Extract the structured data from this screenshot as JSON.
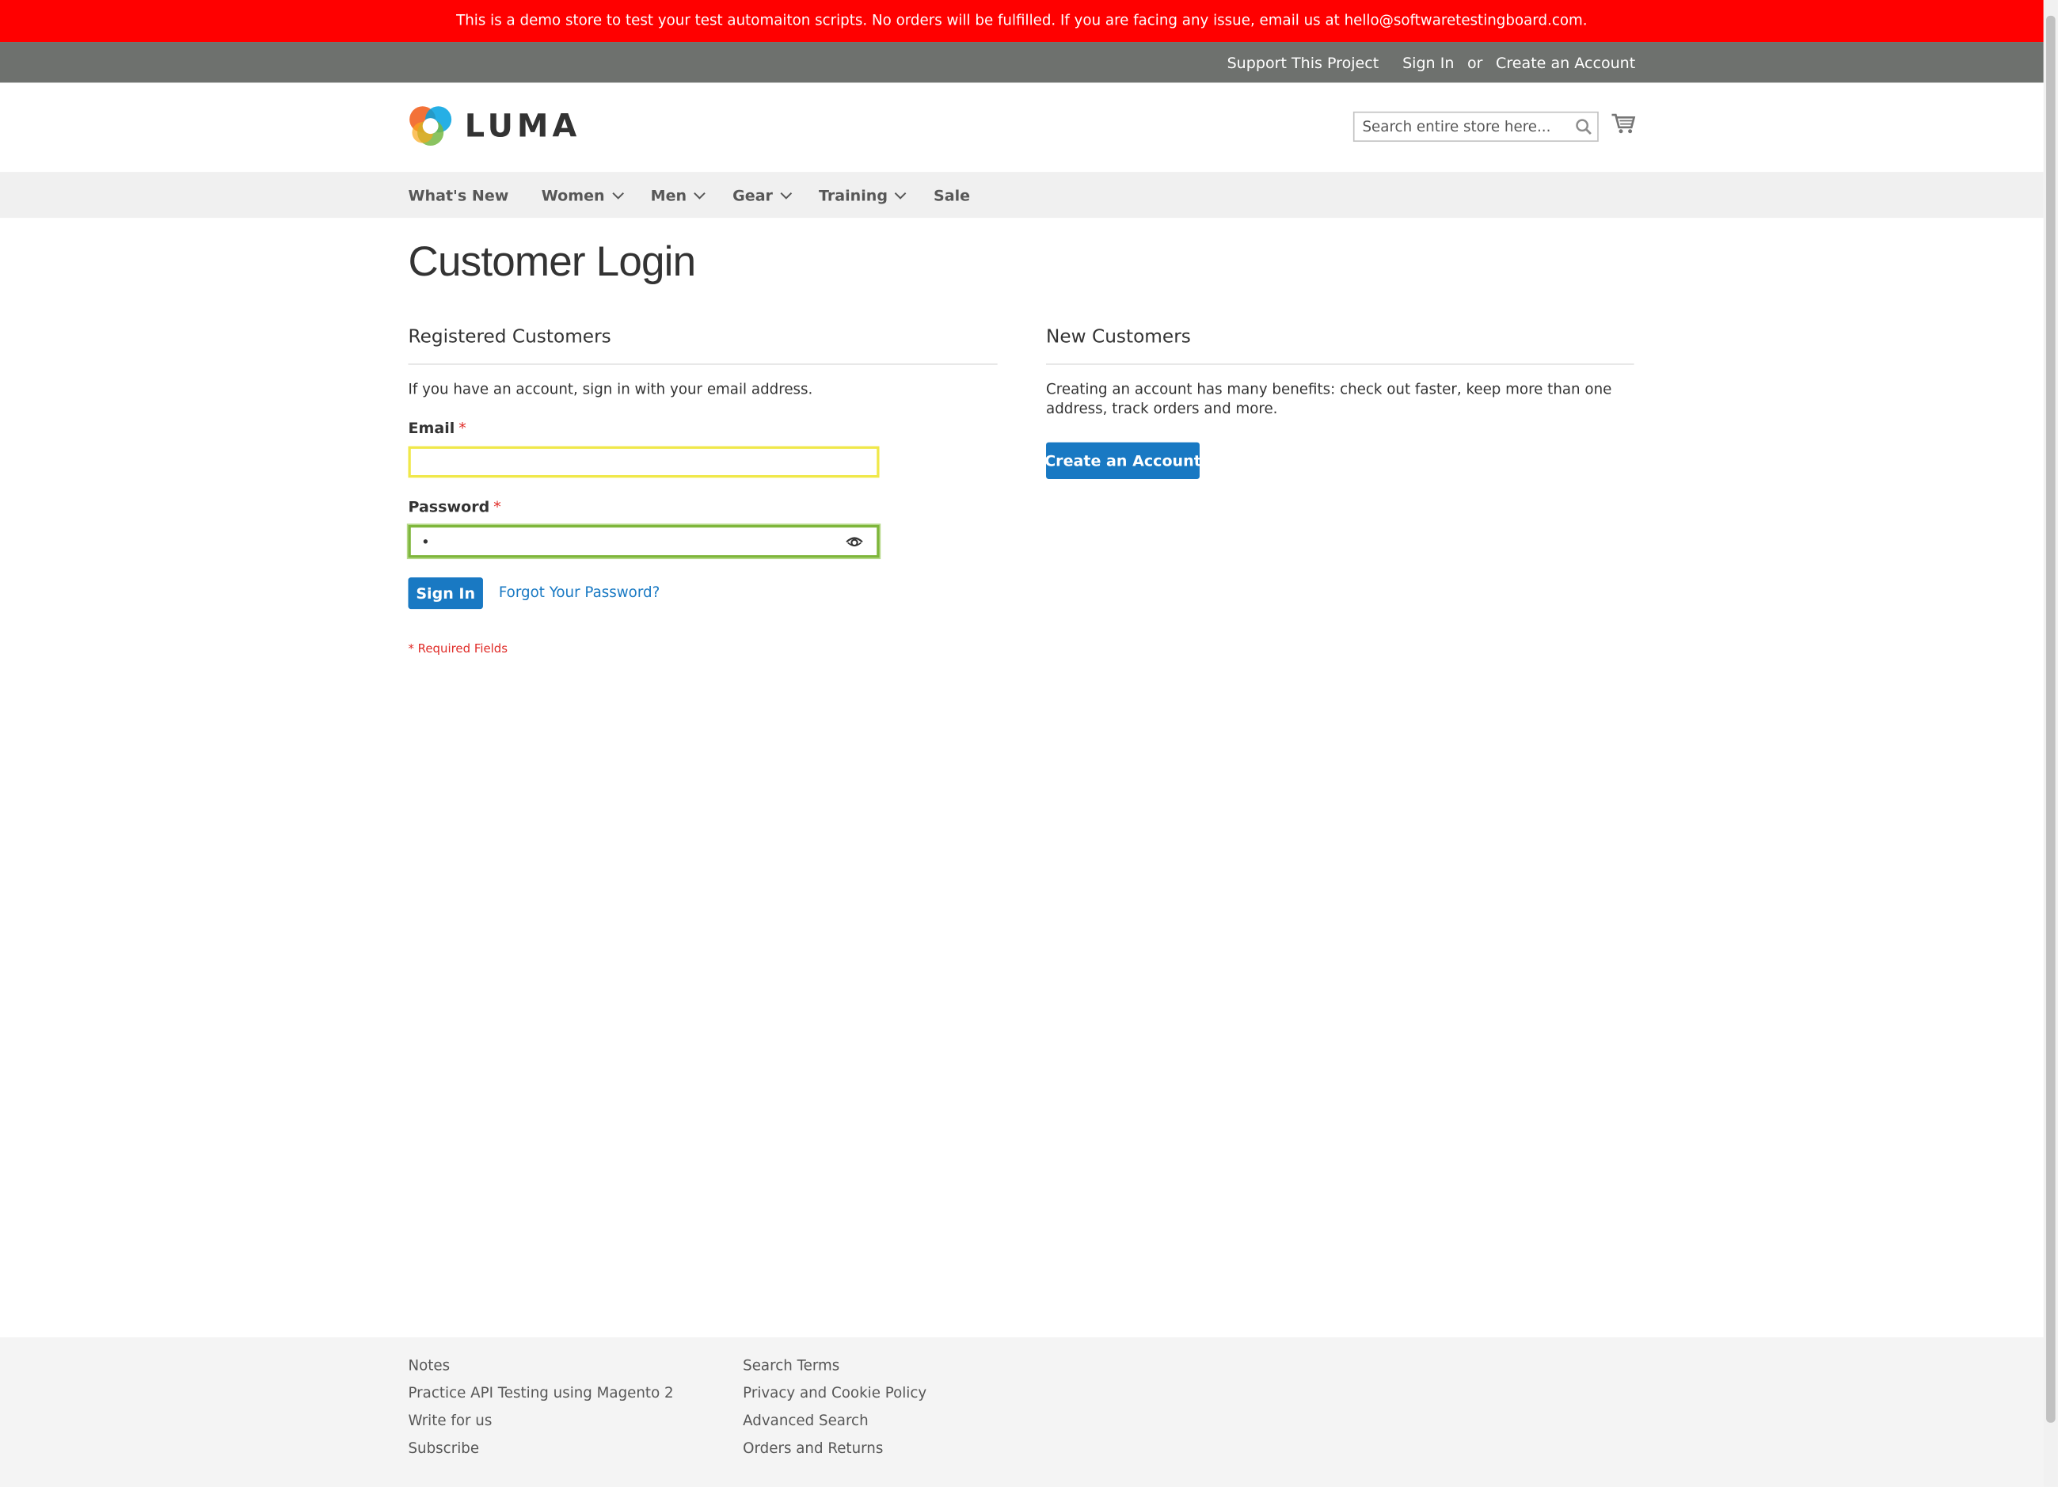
{
  "notice": {
    "text": "This is a demo store to test your test automaiton scripts. No orders will be fulfilled. If you are facing any issue, email us at hello@softwaretestingboard.com."
  },
  "header_links": {
    "support": "Support This Project",
    "sign_in": "Sign In",
    "or": "or",
    "create": "Create an Account"
  },
  "logo": {
    "text": "LUMA",
    "icon": "luma-logo-icon"
  },
  "search": {
    "placeholder": "Search entire store here...",
    "value": "",
    "icon": "search-icon"
  },
  "cart": {
    "icon": "cart-icon"
  },
  "nav": {
    "items": [
      "What's New",
      "Women",
      "Men",
      "Gear",
      "Training",
      "Sale"
    ]
  },
  "page": {
    "title": "Customer Login"
  },
  "registered": {
    "title": "Registered Customers",
    "intro": "If you have an account, sign in with your email address.",
    "email_label": "Email",
    "email_value": "",
    "password_label": "Password",
    "password_value": "•",
    "required_mark": "*",
    "sign_in": "Sign In",
    "forgot": "Forgot Your Password?",
    "required_note": "* Required Fields"
  },
  "new_customers": {
    "title": "New Customers",
    "text": "Creating an account has many benefits: check out faster, keep more than one address, track orders and more.",
    "button": "Create an Account"
  },
  "footer": {
    "col1": [
      "Notes",
      "Practice API Testing using Magento 2",
      "Write for us",
      "Subscribe"
    ],
    "col2": [
      "Search Terms",
      "Privacy and Cookie Policy",
      "Advanced Search",
      "Orders and Returns"
    ]
  },
  "colors": {
    "notice_bg": "#ff0000",
    "header_bg": "#6e716e",
    "nav_bg": "#f0f0f0",
    "accent": "#1979c3",
    "required": "#e02b27",
    "footer_bg": "#f4f4f4"
  }
}
